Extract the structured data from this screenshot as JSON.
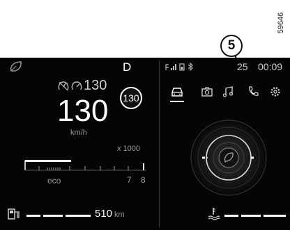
{
  "figure_ref": "59646",
  "callout": {
    "number": "5"
  },
  "left_panel": {
    "gear": "D",
    "cruise_speed": "130",
    "speed": "130",
    "speed_limit": "130",
    "speed_unit": "km/h",
    "rpm_multiplier": "x 1000",
    "drive_mode": "eco",
    "rpm_tick_7": "7",
    "rpm_tick_8": "8",
    "range_value": "510",
    "range_unit": "km",
    "rpm_level": 0.33,
    "fuel_level": 0.55
  },
  "right_panel": {
    "temperature": "25",
    "clock": "00:09",
    "tabs": [
      "vehicle-icon",
      "camera-icon",
      "music-icon",
      "phone-icon",
      "settings-icon"
    ],
    "active_tab": "vehicle-icon",
    "coolant_level": 0.3
  },
  "colors": {
    "screen_bg": "#050505",
    "text": "#ffffff",
    "muted": "#9a9a9a",
    "accent": "#9a9a9a"
  }
}
